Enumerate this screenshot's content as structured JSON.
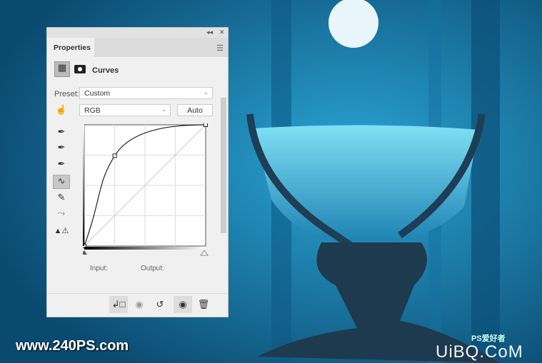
{
  "panel": {
    "tab": "Properties",
    "collapse_icon": "double-chevron-left-icon",
    "close_icon": "close-icon",
    "adjustment_title": "Curves",
    "preset_label": "Preset:",
    "preset_value": "Custom",
    "channel_value": "RGB",
    "auto_label": "Auto",
    "input_label": "Input:",
    "output_label": "Output:",
    "tools": [
      "on-image-adjust-icon",
      "black-point-eyedropper-icon",
      "gray-point-eyedropper-icon",
      "white-point-eyedropper-icon",
      "curve-points-icon",
      "pencil-icon",
      "smooth-icon",
      "clipping-warning-icon"
    ],
    "footer_icons": [
      "clip-to-layer-icon",
      "view-previous-state-icon",
      "reset-icon",
      "visibility-eye-icon",
      "delete-trash-icon"
    ]
  },
  "curve": {
    "points": [
      [
        0,
        0
      ],
      [
        64,
        190
      ],
      [
        255,
        255
      ]
    ]
  },
  "watermarks": {
    "left": "www.240PS.com",
    "right": "UiBQ.CoM",
    "right_small": "PS爱好者"
  },
  "colors": {
    "background": "#1a7fb0",
    "panel": "#f0f0f0"
  }
}
